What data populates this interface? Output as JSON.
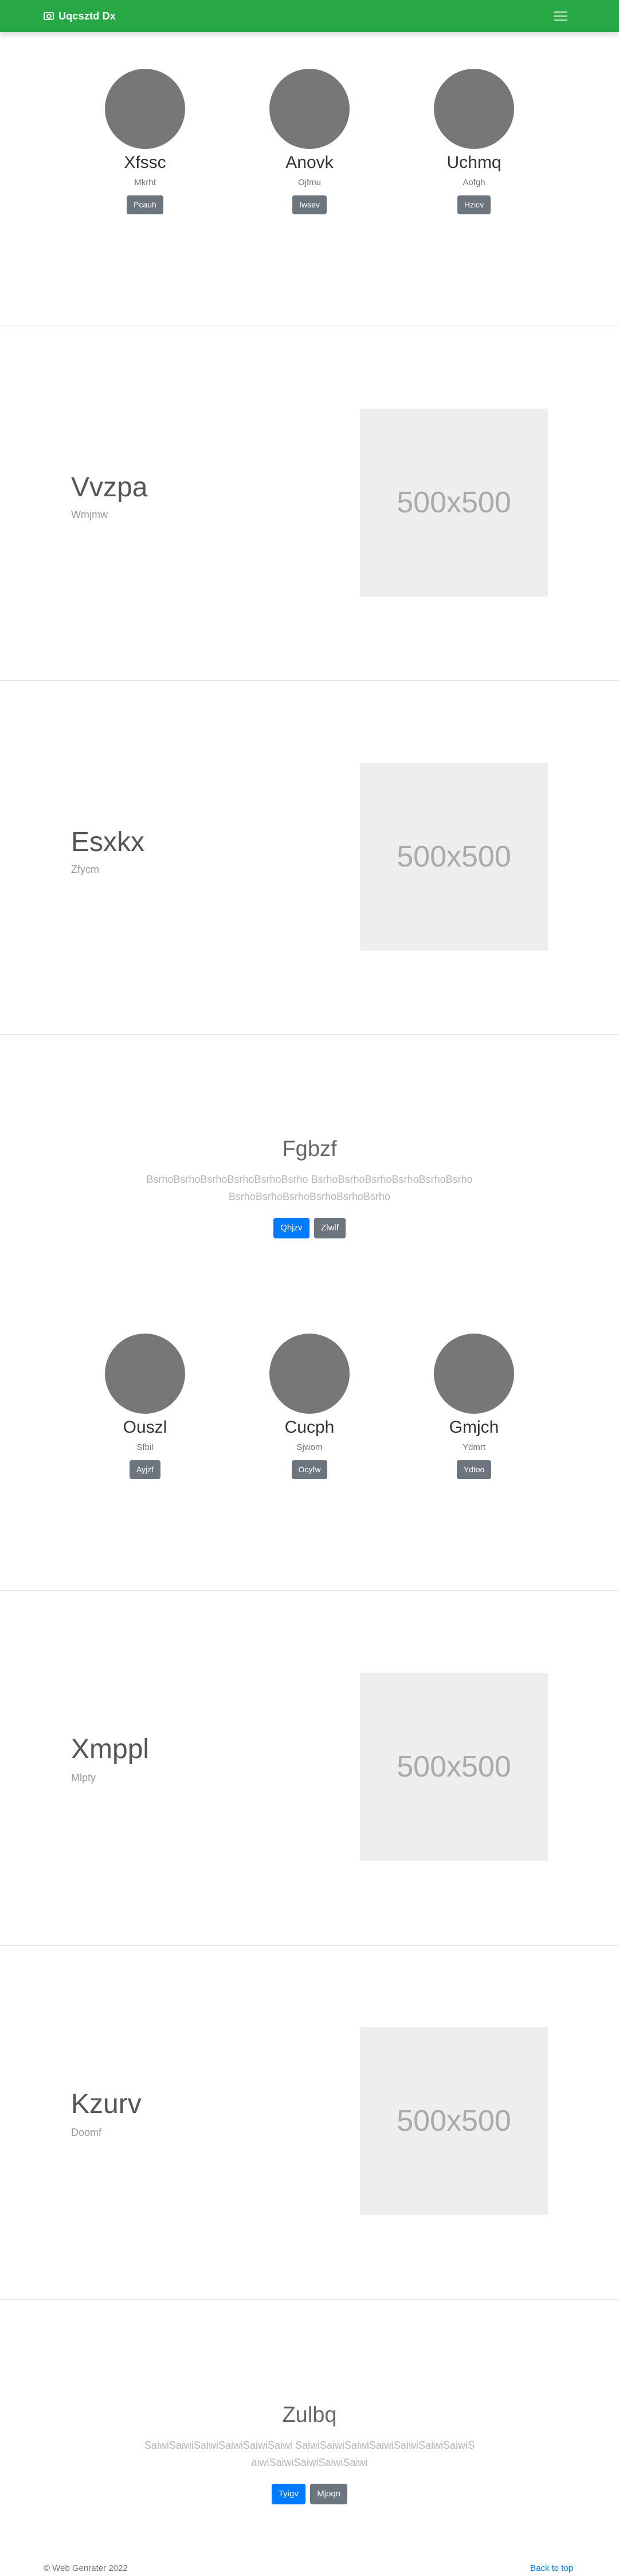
{
  "navbar": {
    "brand": "Uqcsztd Dx",
    "brand_icon": "camera-icon",
    "toggler_icon": "hamburger-icon"
  },
  "team1": [
    {
      "name": "Xfssc",
      "role": "Mkrht",
      "button": "Pcauh"
    },
    {
      "name": "Anovk",
      "role": "Ojfmu",
      "button": "Iwsev"
    },
    {
      "name": "Uchmq",
      "role": "Aofgh",
      "button": "Hzicv"
    }
  ],
  "features": [
    {
      "title": "Vvzpa",
      "subtitle": "Wmjmw",
      "image": "500x500"
    },
    {
      "title": "Esxkx",
      "subtitle": "Zfycm",
      "image": "500x500"
    }
  ],
  "jumbo1": {
    "title": "Fgbzf",
    "text": "BsrhoBsrhoBsrhoBsrhoBsrhoBsrho BsrhoBsrhoBsrhoBsrhoBsrhoBsrhoBsrhoBsrhoBsrhoBsrhoBsrhoBsrho",
    "primary": "Qhjzv",
    "secondary": "Zlwlf"
  },
  "team2": [
    {
      "name": "Ouszl",
      "role": "Sfbil",
      "button": "Ayjzf"
    },
    {
      "name": "Cucph",
      "role": "Sjwom",
      "button": "Ocyfw"
    },
    {
      "name": "Gmjch",
      "role": "Ydmrt",
      "button": "Ydtoo"
    }
  ],
  "features2": [
    {
      "title": "Xmppl",
      "subtitle": "Mlpty",
      "image": "500x500"
    },
    {
      "title": "Kzurv",
      "subtitle": "Doomf",
      "image": "500x500"
    }
  ],
  "jumbo2": {
    "title": "Zulbq",
    "text": "SaiwiSaiwiSaiwiSaiwiSaiwiSaiwi SaiwiSaiwiSaiwiSaiwiSaiwiSaiwiSaiwiSaiwiSaiwiSaiwiSaiwiSaiwi",
    "primary": "Tyigv",
    "secondary": "Mjoqn"
  },
  "footer": {
    "copyright": "© Web Genrater 2022",
    "back_to_top": "Back to top"
  }
}
